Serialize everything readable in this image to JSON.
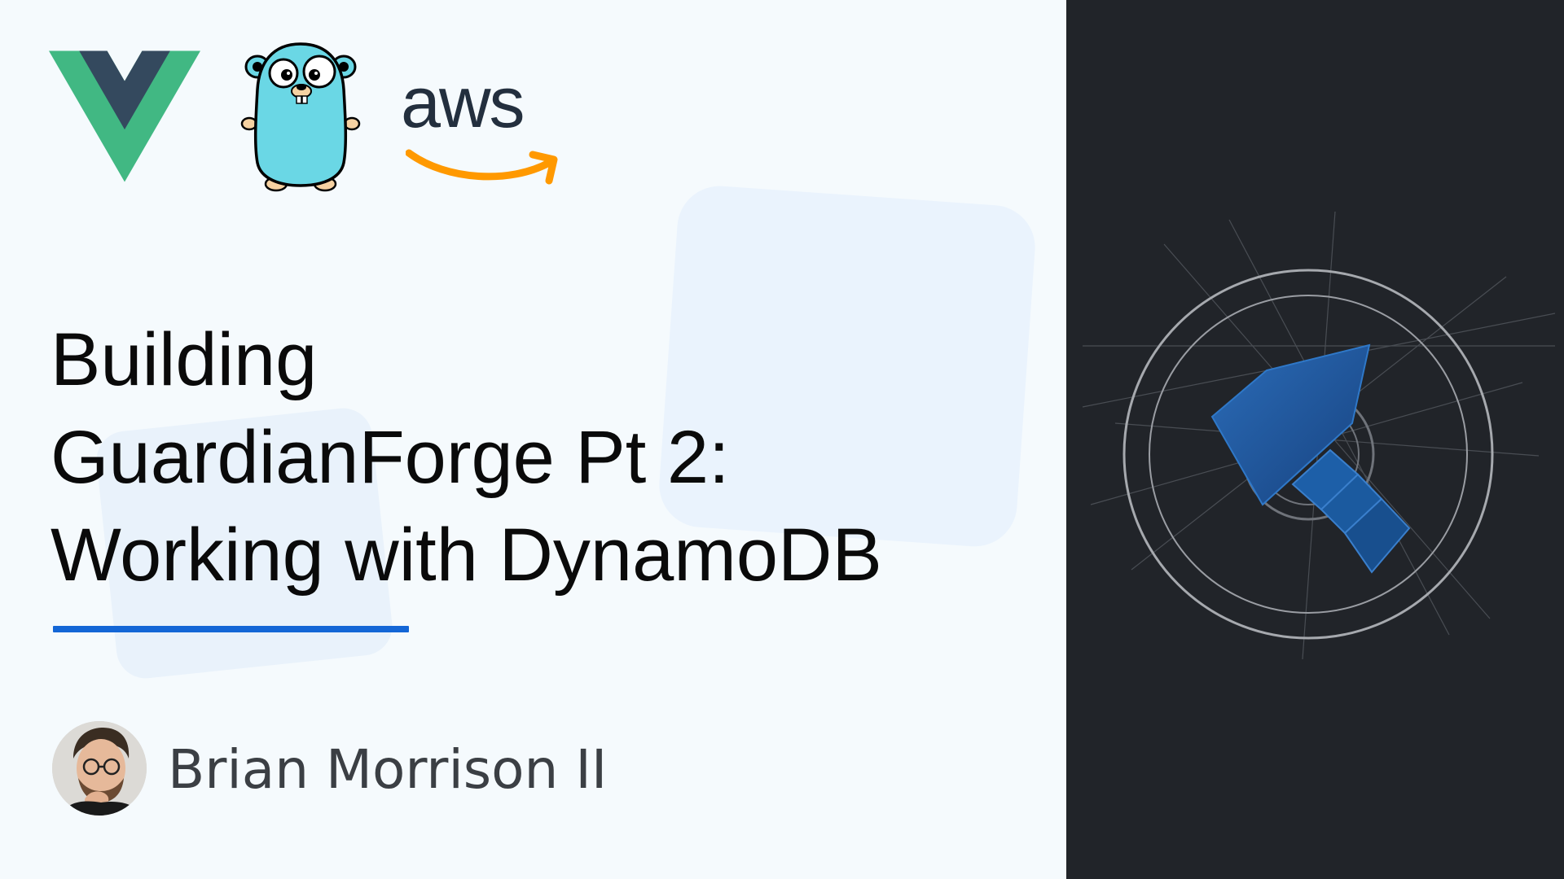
{
  "logos": [
    {
      "name": "vue",
      "icon": "vue-logo-icon"
    },
    {
      "name": "go-gopher",
      "icon": "gopher-mascot-icon"
    },
    {
      "name": "aws",
      "icon": "aws-logo-icon",
      "text": "aws"
    }
  ],
  "title": {
    "lines": [
      "Building",
      "GuardianForge Pt 2:",
      "Working with DynamoDB"
    ]
  },
  "author": {
    "name": "Brian Morrison II",
    "avatar_icon": "author-avatar-photo"
  },
  "emblem": {
    "icon": "guardianforge-hammer-logo-icon"
  },
  "colors": {
    "background_left": "#f5fafd",
    "background_right": "#212429",
    "accent_blue": "#1366d6",
    "title_text": "#0a0a0a",
    "author_text": "#3b3f44",
    "vue_green": "#41b883",
    "vue_dark": "#34495e",
    "gopher_blue": "#6ad7e5",
    "aws_orange": "#ff9900",
    "aws_dark": "#232f3e",
    "hammer_blue": "#1d5fa8"
  }
}
